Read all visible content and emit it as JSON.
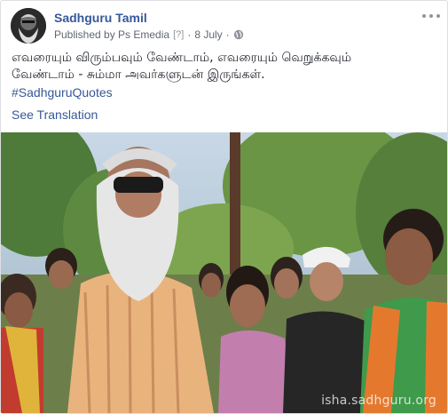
{
  "post": {
    "page_name": "Sadhguru Tamil",
    "published_by": "Published by Ps Emedia",
    "help_marker": "[?]",
    "separator": "·",
    "date": "8 July",
    "separator2": "·",
    "audience_icon": "globe-icon",
    "more_icon": "more-options-icon",
    "text_line1": "எவரையும் விரும்பவும் வேண்டாம், எவரையும் வெறுக்கவும்",
    "text_line2": "வேண்டாம் - சும்மா அவர்களுடன் இருங்கள்.",
    "hashtag": "#SadhguruQuotes",
    "see_translation": "See Translation"
  },
  "photo": {
    "watermark": "isha.sadhguru.org",
    "description_icon": "group-photo"
  },
  "colors": {
    "link": "#365899",
    "meta": "#616770",
    "text": "#1d2129",
    "border": "#dddfe2"
  }
}
